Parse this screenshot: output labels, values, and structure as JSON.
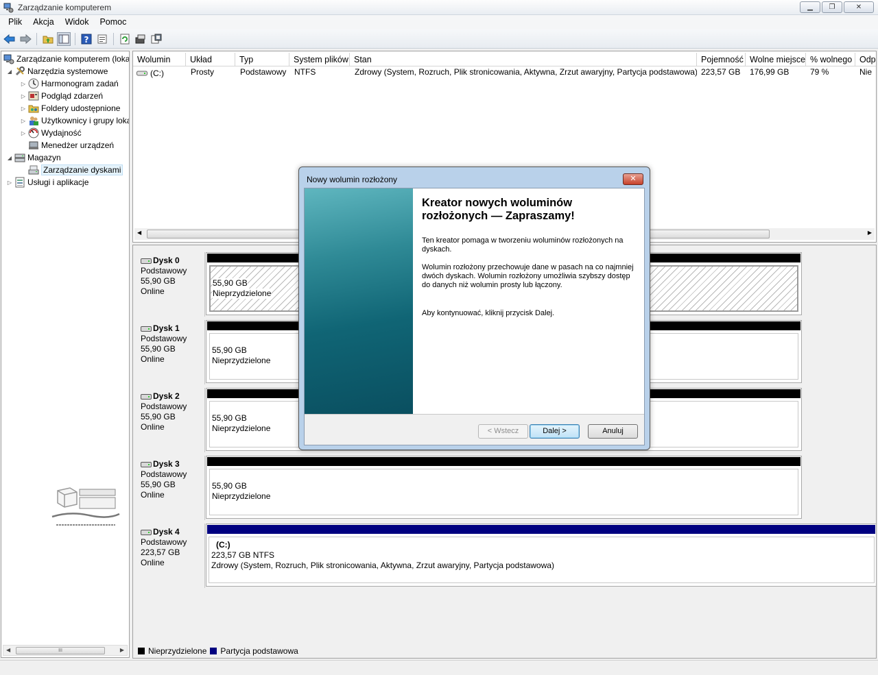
{
  "window": {
    "title": "Zarządzanie komputerem",
    "minimize": "▁",
    "restore": "❐",
    "close": "✕"
  },
  "menu": [
    "Plik",
    "Akcja",
    "Widok",
    "Pomoc"
  ],
  "toolbar_icons": [
    "back-arrow-icon",
    "forward-arrow-icon",
    "up-folder-icon",
    "show-hide-tree-icon",
    "help-icon",
    "properties-icon",
    "refresh-icon",
    "rescan-icon",
    "export-icon"
  ],
  "tree": {
    "root": "Zarządzanie komputerem (lokalne)",
    "items": [
      {
        "label": "Narzędzia systemowe",
        "icon": "tools-icon"
      },
      {
        "label": "Harmonogram zadań",
        "icon": "clock-icon"
      },
      {
        "label": "Podgląd zdarzeń",
        "icon": "event-viewer-icon"
      },
      {
        "label": "Foldery udostępnione",
        "icon": "shared-folder-icon"
      },
      {
        "label": "Użytkownicy i grupy lokalne",
        "icon": "users-icon"
      },
      {
        "label": "Wydajność",
        "icon": "performance-icon"
      },
      {
        "label": "Menedżer urządzeń",
        "icon": "device-manager-icon"
      },
      {
        "label": "Magazyn",
        "icon": "storage-icon"
      },
      {
        "label": "Zarządzanie dyskami",
        "icon": "disk-management-icon"
      },
      {
        "label": "Usługi i aplikacje",
        "icon": "services-icon"
      }
    ],
    "scroll_thumb": "III"
  },
  "volumes": {
    "columns": [
      "Wolumin",
      "Układ",
      "Typ",
      "System plików",
      "Stan",
      "Pojemność",
      "Wolne miejsce",
      "% wolnego",
      "Odporność na błędy"
    ],
    "rows": [
      [
        "(C:)",
        "Prosty",
        "Podstawowy",
        "NTFS",
        "Zdrowy (System, Rozruch, Plik stronicowania, Aktywna, Zrzut awaryjny, Partycja podstawowa)",
        "223,57 GB",
        "176,99 GB",
        "79 %",
        "Nie"
      ]
    ]
  },
  "disks": [
    {
      "name": "Dysk 0",
      "type": "Podstawowy",
      "size": "55,90 GB",
      "status": "Online",
      "part_size": "55,90 GB",
      "part_label": "Nieprzydzielone"
    },
    {
      "name": "Dysk 1",
      "type": "Podstawowy",
      "size": "55,90 GB",
      "status": "Online",
      "part_size": "55,90 GB",
      "part_label": "Nieprzydzielone"
    },
    {
      "name": "Dysk 2",
      "type": "Podstawowy",
      "size": "55,90 GB",
      "status": "Online",
      "part_size": "55,90 GB",
      "part_label": "Nieprzydzielone"
    },
    {
      "name": "Dysk 3",
      "type": "Podstawowy",
      "size": "55,90 GB",
      "status": "Online",
      "part_size": "55,90 GB",
      "part_label": "Nieprzydzielone"
    },
    {
      "name": "Dysk 4",
      "type": "Podstawowy",
      "size": "223,57 GB",
      "status": "Online",
      "part_name": "(C:)",
      "part_size": "223,57 GB NTFS",
      "part_label": "Zdrowy (System, Rozruch, Plik stronicowania, Aktywna, Zrzut awaryjny, Partycja podstawowa)"
    }
  ],
  "legend": [
    {
      "label": "Nieprzydzielone",
      "color": "#000000"
    },
    {
      "label": "Partycja podstawowa",
      "color": "#000080"
    }
  ],
  "dialog": {
    "title": "Nowy wolumin rozłożony",
    "close": "✕",
    "heading": "Kreator nowych woluminów rozłożonych — Zapraszamy!",
    "p1": "Ten kreator pomaga w tworzeniu woluminów rozłożonych na dyskach.",
    "p2": "Wolumin rozłożony przechowuje dane w pasach na co najmniej dwóch dyskach. Wolumin rozłożony umożliwia szybszy dostęp do danych niż wolumin prosty lub łączony.",
    "p3": "Aby kontynuować, kliknij przycisk Dalej.",
    "back": "< Wstecz",
    "next": "Dalej >",
    "cancel": "Anuluj"
  },
  "colors": {
    "primary_partition": "#000080",
    "unallocated": "#000000",
    "wizard_teal": "#106575"
  }
}
